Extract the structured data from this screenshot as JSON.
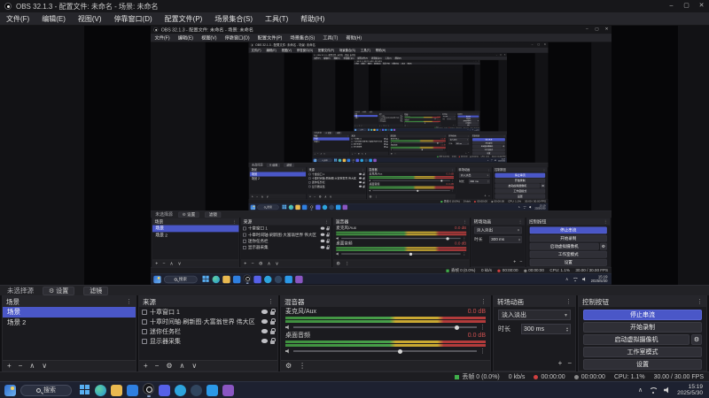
{
  "window": {
    "title": "OBS 32.1.3 - 配置文件: 未命名 - 场景: 未命名",
    "controls": {
      "minimize": "–",
      "maximize": "▢",
      "close": "✕"
    }
  },
  "menu": {
    "items": [
      "文件(F)",
      "编辑(E)",
      "视图(V)",
      "停靠窗口(D)",
      "配置文件(P)",
      "场景集合(S)",
      "工具(T)",
      "帮助(H)"
    ]
  },
  "source_toolbar": {
    "no_source_label": "未选择源",
    "properties_button": "设置",
    "filters_button": "滤镜"
  },
  "docks": {
    "scenes": {
      "title": "场景",
      "items": [
        "场景",
        "场景 2"
      ],
      "selected_index": 0
    },
    "sources": {
      "title": "来源",
      "items": [
        "十章窗口 1",
        "十章时间轴·刷新图·大富翁世界 伟大区",
        "迷你任务栏",
        "显示器采集"
      ]
    },
    "mixer": {
      "title": "混音器",
      "channels": [
        {
          "name": "麦克风/Aux",
          "db": "0.0 dB",
          "slider_pos": "88%"
        },
        {
          "name": "桌面音频",
          "db": "0.0 dB",
          "slider_pos": "57%"
        }
      ]
    },
    "transitions": {
      "title": "转场动画",
      "selected": "淡入淡出",
      "duration_label": "时长",
      "duration_value": "300 ms"
    },
    "controls": {
      "title": "控制按钮",
      "buttons": [
        "停止串流",
        "开始录制",
        "启动虚拟摄像机",
        "工作室模式",
        "设置"
      ]
    }
  },
  "status_bar": {
    "dropped_frames": "丢帧 0 (0.0%)",
    "bitrate": "0 kb/s",
    "live_time": "00:00:00",
    "rec_time": "00:00:00",
    "cpu": "CPU: 1.1%",
    "fps": "30.00 / 30.00 FPS"
  },
  "taskbar": {
    "search_label": "搜索",
    "time": "15:19",
    "date": "2025/5/30"
  },
  "icons": {
    "gear": "⚙",
    "kebab": "⋮",
    "plus": "+",
    "minus": "−",
    "up": "∧",
    "down": "∨",
    "caret_down": "▾",
    "spin_up": "▴",
    "spin_down": "▾",
    "chevron_up": "∧"
  },
  "colors": {
    "accent_blue": "#4a57c8",
    "meter_green": "#48a04a",
    "meter_yellow": "#c9a832",
    "meter_red": "#b23b3b",
    "live_red": "#d04040",
    "ok_green": "#3fae4a"
  }
}
